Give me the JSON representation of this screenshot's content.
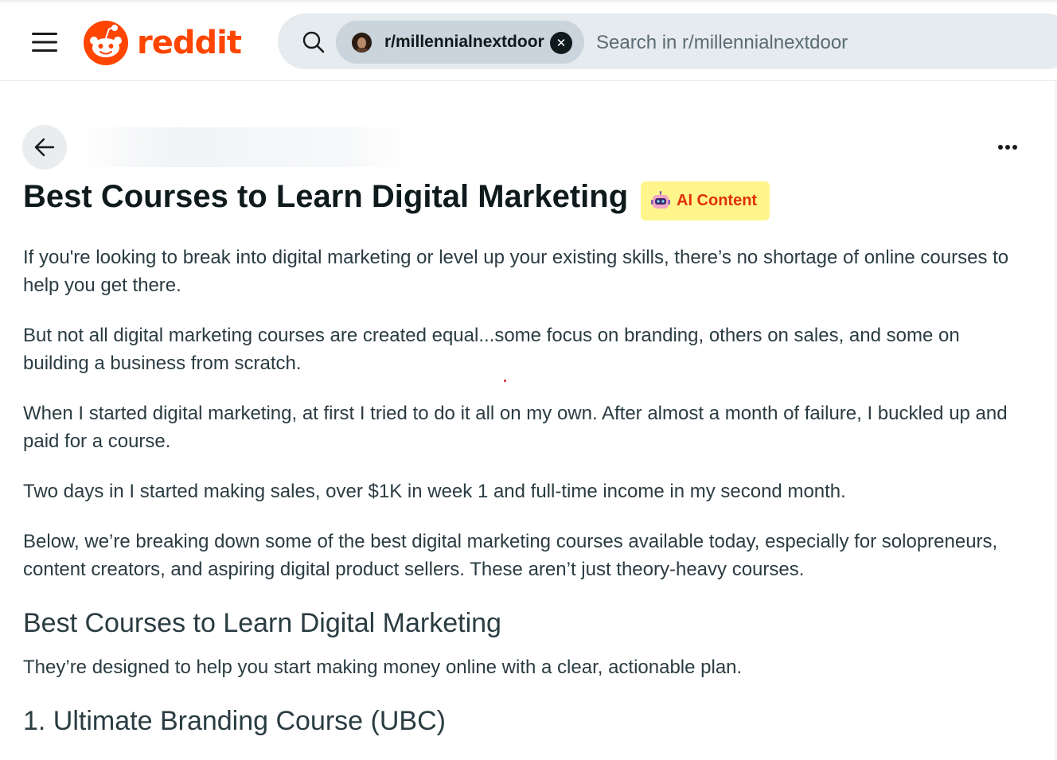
{
  "header": {
    "logo_text": "reddit",
    "search": {
      "chip_label": "r/millennialnextdoor",
      "placeholder": "Search in r/millennialnextdoor"
    },
    "icons": [
      "menu-icon",
      "reddit-snoo-icon",
      "search-icon",
      "close-icon"
    ]
  },
  "post": {
    "title": "Best Courses to Learn Digital Marketing",
    "badge_label": "AI Content",
    "paragraphs": [
      "If you're looking to break into digital marketing or level up your existing skills, there’s no shortage of online courses to help you get there.",
      "But not all digital marketing courses are created equal...some focus on branding, others on sales, and some on building a business from scratch.",
      "When I started digital marketing, at first I tried to do it all on my own. After almost a month of failure, I buckled up and paid for a course.",
      "Two days in I started making sales, over $1K in week 1 and full-time income in my second month.",
      "Below, we’re breaking down some of the best digital marketing courses available today, especially for solopreneurs, content creators, and aspiring digital product sellers. These aren’t just theory-heavy courses."
    ],
    "section_heading": "Best Courses to Learn Digital Marketing",
    "section_paragraph": "They’re designed to help you start making money online with a clear, actionable plan.",
    "item_heading": "1. Ultimate Branding Course (UBC)"
  },
  "colors": {
    "brand": "#ff4500",
    "search_bg": "#e5ebee",
    "chip_bg": "#c9d4dc",
    "badge_bg": "#fff58a",
    "badge_text": "#e0300a",
    "body_text": "#2a3c42"
  }
}
